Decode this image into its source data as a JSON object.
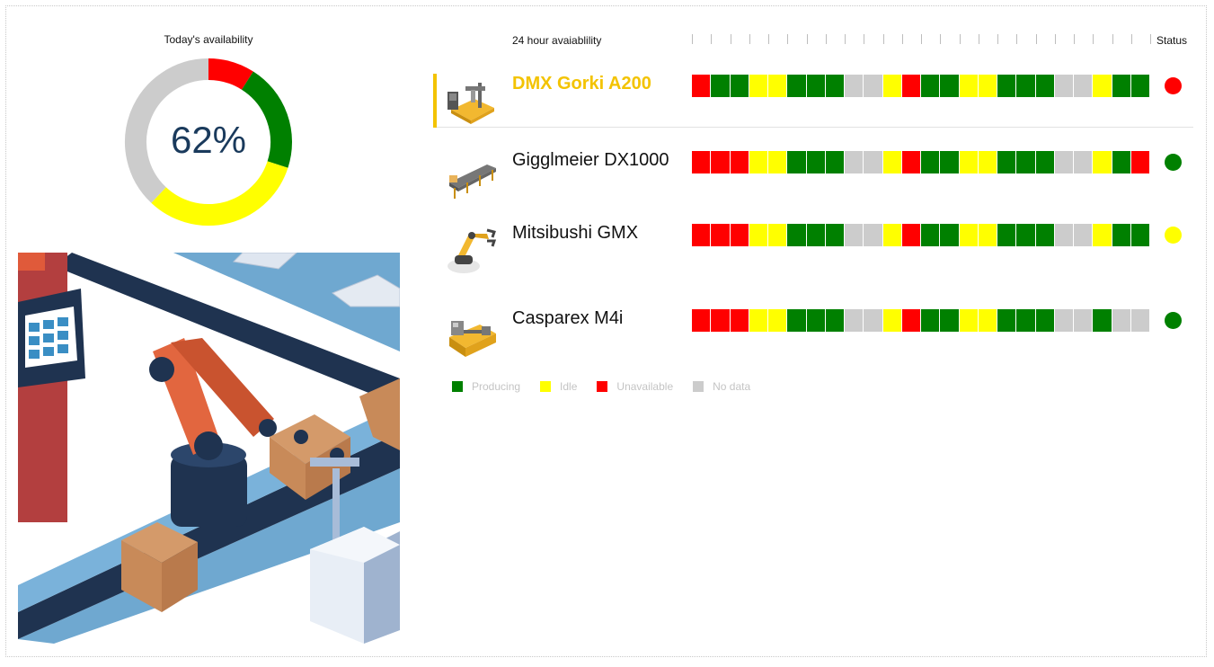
{
  "availability": {
    "title": "Today's availability",
    "percent_label": "62%",
    "segments": [
      {
        "state": "unavailable",
        "fraction": 0.09
      },
      {
        "state": "producing",
        "fraction": 0.21
      },
      {
        "state": "idle",
        "fraction": 0.32
      },
      {
        "state": "no_data",
        "fraction": 0.38
      }
    ]
  },
  "timeline": {
    "title": "24 hour avaiablility",
    "status_header": "Status",
    "tick_count": 25
  },
  "colors": {
    "producing": "#008000",
    "idle": "#ffff00",
    "unavailable": "#ff0000",
    "no_data": "#cccccc",
    "accent": "#f3c300"
  },
  "machines": [
    {
      "name": "DMX Gorki A200",
      "icon": "cnc-router-icon",
      "selected": true,
      "status": "unavailable",
      "hours": [
        "unavailable",
        "producing",
        "producing",
        "idle",
        "idle",
        "producing",
        "producing",
        "producing",
        "no_data",
        "no_data",
        "idle",
        "unavailable",
        "producing",
        "producing",
        "idle",
        "idle",
        "producing",
        "producing",
        "producing",
        "no_data",
        "no_data",
        "idle",
        "producing",
        "producing"
      ]
    },
    {
      "name": "Gigglmeier DX1000",
      "icon": "conveyor-icon",
      "selected": false,
      "status": "producing",
      "hours": [
        "unavailable",
        "unavailable",
        "unavailable",
        "idle",
        "idle",
        "producing",
        "producing",
        "producing",
        "no_data",
        "no_data",
        "idle",
        "unavailable",
        "producing",
        "producing",
        "idle",
        "idle",
        "producing",
        "producing",
        "producing",
        "no_data",
        "no_data",
        "idle",
        "producing",
        "unavailable"
      ]
    },
    {
      "name": "Mitsibushi GMX",
      "icon": "robot-arm-icon",
      "selected": false,
      "status": "idle",
      "hours": [
        "unavailable",
        "unavailable",
        "unavailable",
        "idle",
        "idle",
        "producing",
        "producing",
        "producing",
        "no_data",
        "no_data",
        "idle",
        "unavailable",
        "producing",
        "producing",
        "idle",
        "idle",
        "producing",
        "producing",
        "producing",
        "no_data",
        "no_data",
        "idle",
        "producing",
        "producing"
      ]
    },
    {
      "name": "Casparex M4i",
      "icon": "lathe-icon",
      "selected": false,
      "status": "producing",
      "hours": [
        "unavailable",
        "unavailable",
        "unavailable",
        "idle",
        "idle",
        "producing",
        "producing",
        "producing",
        "no_data",
        "no_data",
        "idle",
        "unavailable",
        "producing",
        "producing",
        "idle",
        "idle",
        "producing",
        "producing",
        "producing",
        "no_data",
        "no_data",
        "producing",
        "no_data",
        "no_data"
      ]
    }
  ],
  "legend": [
    {
      "state": "producing",
      "label": "Producing"
    },
    {
      "state": "idle",
      "label": "Idle"
    },
    {
      "state": "unavailable",
      "label": "Unavailable"
    },
    {
      "state": "no_data",
      "label": "No data"
    }
  ],
  "illustration": {
    "icon": "factory-robot-illustration"
  }
}
